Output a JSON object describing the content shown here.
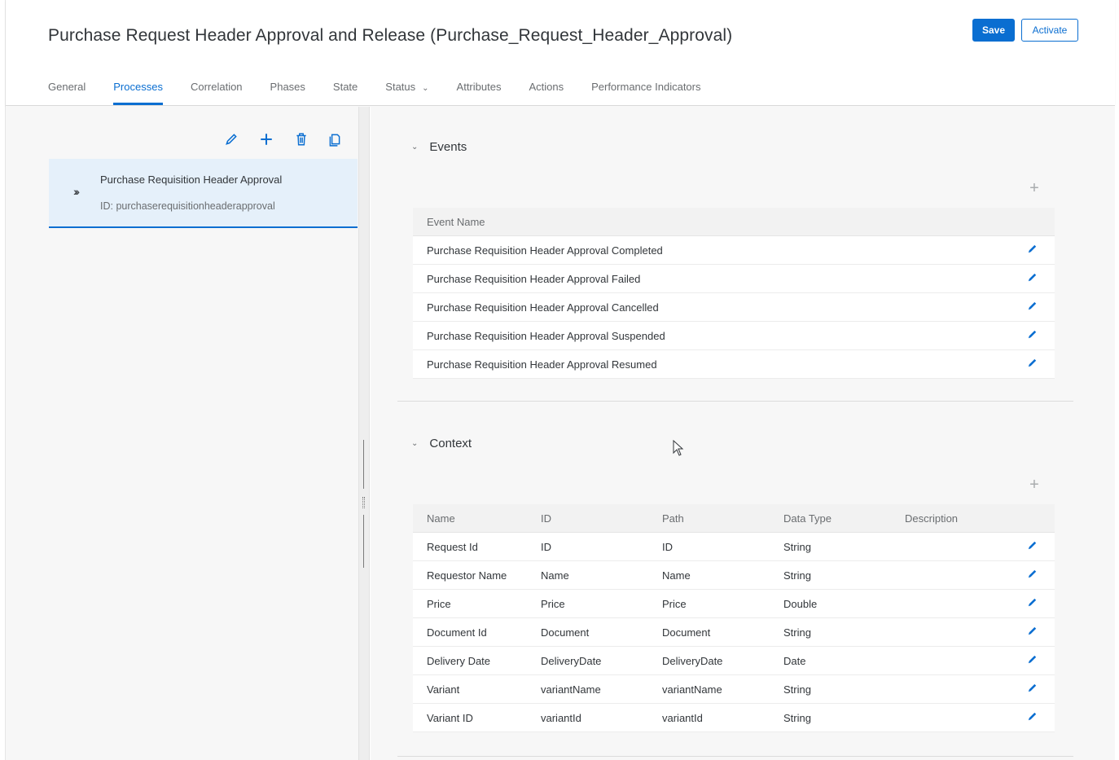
{
  "header": {
    "title": "Purchase Request Header Approval and Release (Purchase_Request_Header_Approval)",
    "save_label": "Save",
    "activate_label": "Activate",
    "accent_color": "#0a6ed1"
  },
  "tabs": [
    {
      "label": "General"
    },
    {
      "label": "Processes",
      "active": true
    },
    {
      "label": "Correlation"
    },
    {
      "label": "Phases"
    },
    {
      "label": "State"
    },
    {
      "label": "Status"
    },
    {
      "label": "Attributes"
    },
    {
      "label": "Actions"
    },
    {
      "label": "Performance Indicators"
    }
  ],
  "toolbar": {
    "icons": [
      "edit-icon",
      "add-icon",
      "delete-icon",
      "copy-icon"
    ]
  },
  "process": {
    "title": "Purchase Requisition Header Approval",
    "id_text": "ID: purchaserequisitionheaderapproval"
  },
  "events": {
    "section_label": "Events",
    "column_header": "Event Name",
    "rows": [
      "Purchase Requisition Header Approval Completed",
      "Purchase Requisition Header Approval Failed",
      "Purchase Requisition Header Approval Cancelled",
      "Purchase Requisition Header Approval Suspended",
      "Purchase Requisition Header Approval Resumed"
    ]
  },
  "context": {
    "section_label": "Context",
    "columns": [
      "Name",
      "ID",
      "Path",
      "Data Type",
      "Description"
    ],
    "rows": [
      {
        "name": "Request Id",
        "id": "ID",
        "path": "ID",
        "type": "String",
        "description": ""
      },
      {
        "name": "Requestor Name",
        "id": "Name",
        "path": "Name",
        "type": "String",
        "description": ""
      },
      {
        "name": "Price",
        "id": "Price",
        "path": "Price",
        "type": "Double",
        "description": ""
      },
      {
        "name": "Document Id",
        "id": "Document",
        "path": "Document",
        "type": "String",
        "description": ""
      },
      {
        "name": "Delivery Date",
        "id": "DeliveryDate",
        "path": "DeliveryDate",
        "type": "Date",
        "description": ""
      },
      {
        "name": "Variant",
        "id": "variantName",
        "path": "variantName",
        "type": "String",
        "description": ""
      },
      {
        "name": "Variant ID",
        "id": "variantId",
        "path": "variantId",
        "type": "String",
        "description": ""
      }
    ]
  }
}
